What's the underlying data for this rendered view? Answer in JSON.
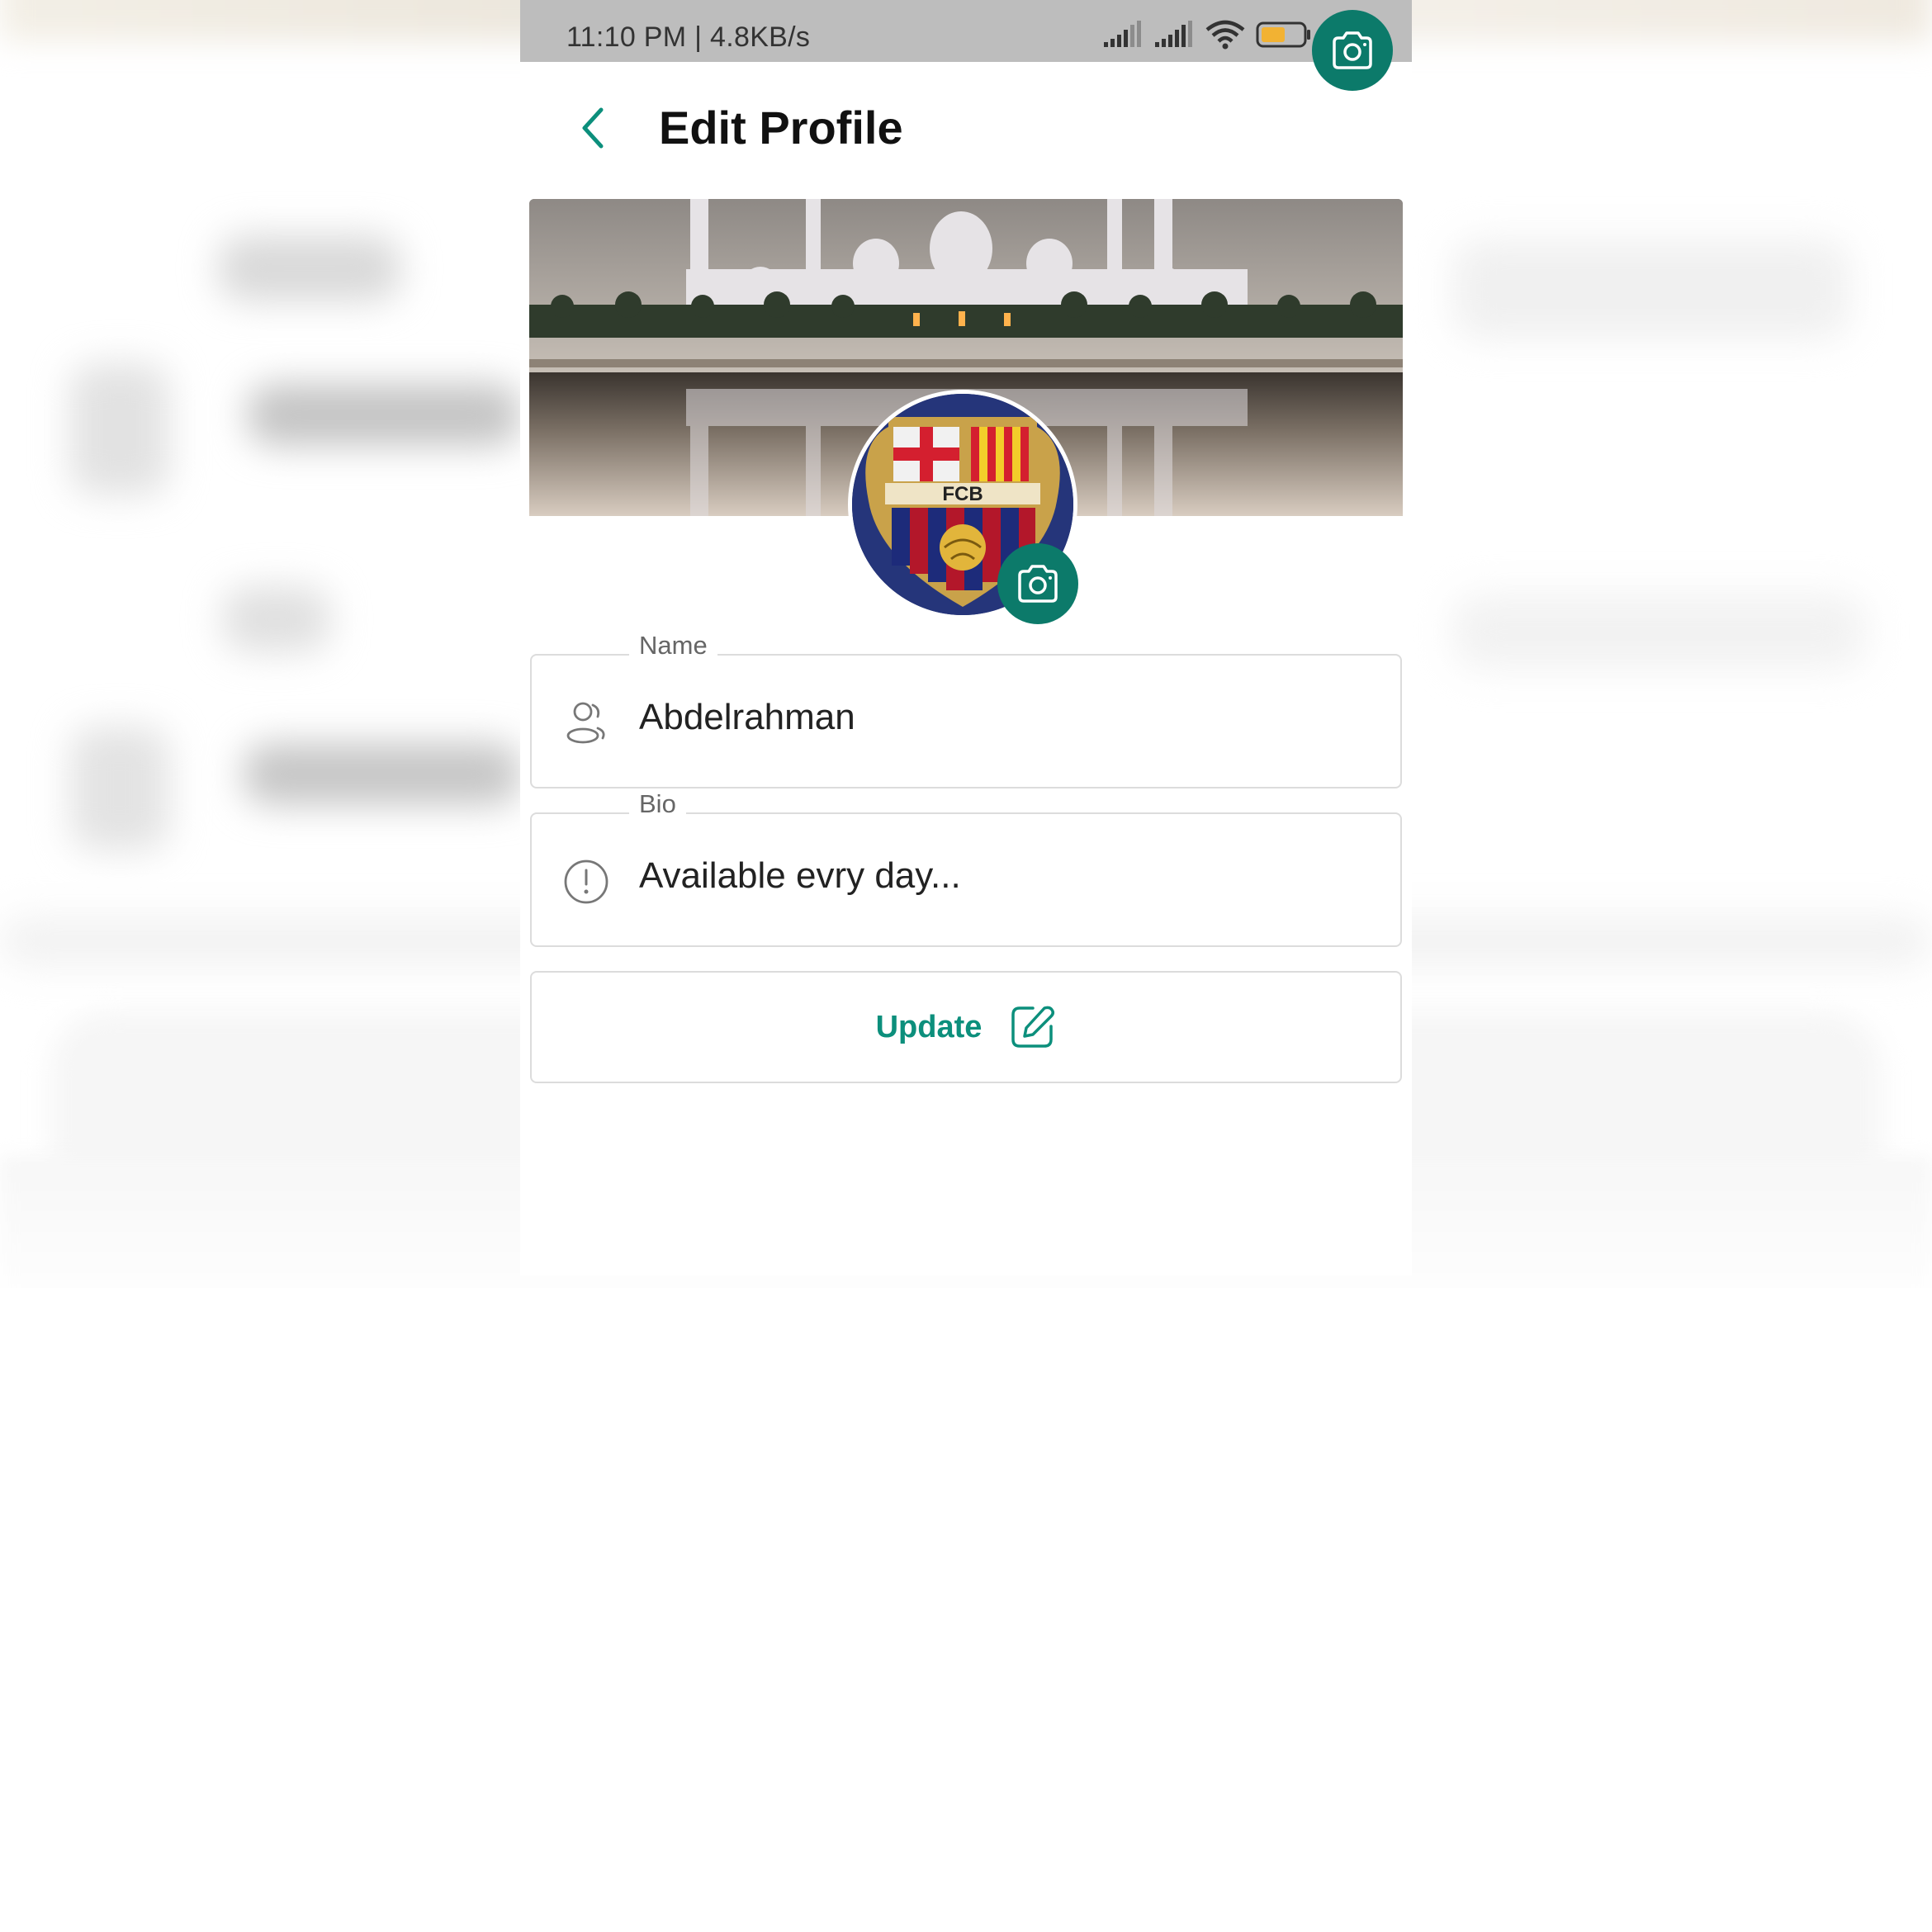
{
  "status_bar": {
    "time_speed": "11:10 PM | 4.8KB/s",
    "battery_value": "59",
    "battery_unit": "%",
    "battery_level": 0.59
  },
  "header": {
    "title": "Edit Profile",
    "back_icon": "chevron-left-icon"
  },
  "cover": {
    "camera_icon": "camera-icon"
  },
  "avatar": {
    "camera_icon": "camera-icon",
    "logo_text": "FCB"
  },
  "form": {
    "name": {
      "label": "Name",
      "value": "Abdelrahman",
      "icon": "user-group-icon"
    },
    "bio": {
      "label": "Bio",
      "value": "Available evry day...",
      "icon": "info-circle-icon"
    }
  },
  "update_button": {
    "label": "Update",
    "icon": "edit-icon"
  },
  "colors": {
    "accent": "#0c7a6a",
    "accent_text": "#0c8f7c",
    "status_bar": "#bdbdbd",
    "battery_fill": "#f2b233"
  }
}
